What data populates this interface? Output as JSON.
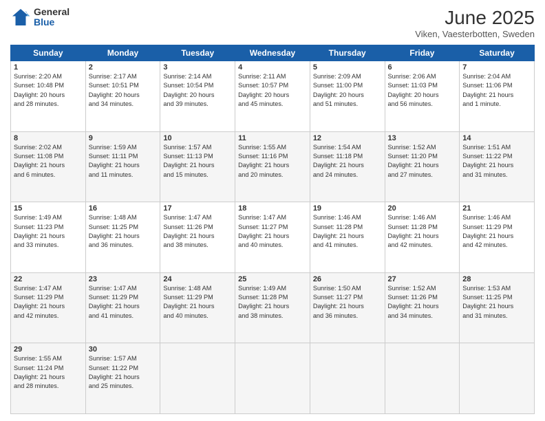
{
  "logo": {
    "general": "General",
    "blue": "Blue"
  },
  "title": "June 2025",
  "subtitle": "Viken, Vaesterbotten, Sweden",
  "days_header": [
    "Sunday",
    "Monday",
    "Tuesday",
    "Wednesday",
    "Thursday",
    "Friday",
    "Saturday"
  ],
  "weeks": [
    [
      {
        "day": "1",
        "lines": [
          "Sunrise: 2:20 AM",
          "Sunset: 10:48 PM",
          "Daylight: 20 hours",
          "and 28 minutes."
        ]
      },
      {
        "day": "2",
        "lines": [
          "Sunrise: 2:17 AM",
          "Sunset: 10:51 PM",
          "Daylight: 20 hours",
          "and 34 minutes."
        ]
      },
      {
        "day": "3",
        "lines": [
          "Sunrise: 2:14 AM",
          "Sunset: 10:54 PM",
          "Daylight: 20 hours",
          "and 39 minutes."
        ]
      },
      {
        "day": "4",
        "lines": [
          "Sunrise: 2:11 AM",
          "Sunset: 10:57 PM",
          "Daylight: 20 hours",
          "and 45 minutes."
        ]
      },
      {
        "day": "5",
        "lines": [
          "Sunrise: 2:09 AM",
          "Sunset: 11:00 PM",
          "Daylight: 20 hours",
          "and 51 minutes."
        ]
      },
      {
        "day": "6",
        "lines": [
          "Sunrise: 2:06 AM",
          "Sunset: 11:03 PM",
          "Daylight: 20 hours",
          "and 56 minutes."
        ]
      },
      {
        "day": "7",
        "lines": [
          "Sunrise: 2:04 AM",
          "Sunset: 11:06 PM",
          "Daylight: 21 hours",
          "and 1 minute."
        ]
      }
    ],
    [
      {
        "day": "8",
        "lines": [
          "Sunrise: 2:02 AM",
          "Sunset: 11:08 PM",
          "Daylight: 21 hours",
          "and 6 minutes."
        ]
      },
      {
        "day": "9",
        "lines": [
          "Sunrise: 1:59 AM",
          "Sunset: 11:11 PM",
          "Daylight: 21 hours",
          "and 11 minutes."
        ]
      },
      {
        "day": "10",
        "lines": [
          "Sunrise: 1:57 AM",
          "Sunset: 11:13 PM",
          "Daylight: 21 hours",
          "and 15 minutes."
        ]
      },
      {
        "day": "11",
        "lines": [
          "Sunrise: 1:55 AM",
          "Sunset: 11:16 PM",
          "Daylight: 21 hours",
          "and 20 minutes."
        ]
      },
      {
        "day": "12",
        "lines": [
          "Sunrise: 1:54 AM",
          "Sunset: 11:18 PM",
          "Daylight: 21 hours",
          "and 24 minutes."
        ]
      },
      {
        "day": "13",
        "lines": [
          "Sunrise: 1:52 AM",
          "Sunset: 11:20 PM",
          "Daylight: 21 hours",
          "and 27 minutes."
        ]
      },
      {
        "day": "14",
        "lines": [
          "Sunrise: 1:51 AM",
          "Sunset: 11:22 PM",
          "Daylight: 21 hours",
          "and 31 minutes."
        ]
      }
    ],
    [
      {
        "day": "15",
        "lines": [
          "Sunrise: 1:49 AM",
          "Sunset: 11:23 PM",
          "Daylight: 21 hours",
          "and 33 minutes."
        ]
      },
      {
        "day": "16",
        "lines": [
          "Sunrise: 1:48 AM",
          "Sunset: 11:25 PM",
          "Daylight: 21 hours",
          "and 36 minutes."
        ]
      },
      {
        "day": "17",
        "lines": [
          "Sunrise: 1:47 AM",
          "Sunset: 11:26 PM",
          "Daylight: 21 hours",
          "and 38 minutes."
        ]
      },
      {
        "day": "18",
        "lines": [
          "Sunrise: 1:47 AM",
          "Sunset: 11:27 PM",
          "Daylight: 21 hours",
          "and 40 minutes."
        ]
      },
      {
        "day": "19",
        "lines": [
          "Sunrise: 1:46 AM",
          "Sunset: 11:28 PM",
          "Daylight: 21 hours",
          "and 41 minutes."
        ]
      },
      {
        "day": "20",
        "lines": [
          "Sunrise: 1:46 AM",
          "Sunset: 11:28 PM",
          "Daylight: 21 hours",
          "and 42 minutes."
        ]
      },
      {
        "day": "21",
        "lines": [
          "Sunrise: 1:46 AM",
          "Sunset: 11:29 PM",
          "Daylight: 21 hours",
          "and 42 minutes."
        ]
      }
    ],
    [
      {
        "day": "22",
        "lines": [
          "Sunrise: 1:47 AM",
          "Sunset: 11:29 PM",
          "Daylight: 21 hours",
          "and 42 minutes."
        ]
      },
      {
        "day": "23",
        "lines": [
          "Sunrise: 1:47 AM",
          "Sunset: 11:29 PM",
          "Daylight: 21 hours",
          "and 41 minutes."
        ]
      },
      {
        "day": "24",
        "lines": [
          "Sunrise: 1:48 AM",
          "Sunset: 11:29 PM",
          "Daylight: 21 hours",
          "and 40 minutes."
        ]
      },
      {
        "day": "25",
        "lines": [
          "Sunrise: 1:49 AM",
          "Sunset: 11:28 PM",
          "Daylight: 21 hours",
          "and 38 minutes."
        ]
      },
      {
        "day": "26",
        "lines": [
          "Sunrise: 1:50 AM",
          "Sunset: 11:27 PM",
          "Daylight: 21 hours",
          "and 36 minutes."
        ]
      },
      {
        "day": "27",
        "lines": [
          "Sunrise: 1:52 AM",
          "Sunset: 11:26 PM",
          "Daylight: 21 hours",
          "and 34 minutes."
        ]
      },
      {
        "day": "28",
        "lines": [
          "Sunrise: 1:53 AM",
          "Sunset: 11:25 PM",
          "Daylight: 21 hours",
          "and 31 minutes."
        ]
      }
    ],
    [
      {
        "day": "29",
        "lines": [
          "Sunrise: 1:55 AM",
          "Sunset: 11:24 PM",
          "Daylight: 21 hours",
          "and 28 minutes."
        ]
      },
      {
        "day": "30",
        "lines": [
          "Sunrise: 1:57 AM",
          "Sunset: 11:22 PM",
          "Daylight: 21 hours",
          "and 25 minutes."
        ]
      },
      {
        "day": "",
        "lines": []
      },
      {
        "day": "",
        "lines": []
      },
      {
        "day": "",
        "lines": []
      },
      {
        "day": "",
        "lines": []
      },
      {
        "day": "",
        "lines": []
      }
    ]
  ]
}
